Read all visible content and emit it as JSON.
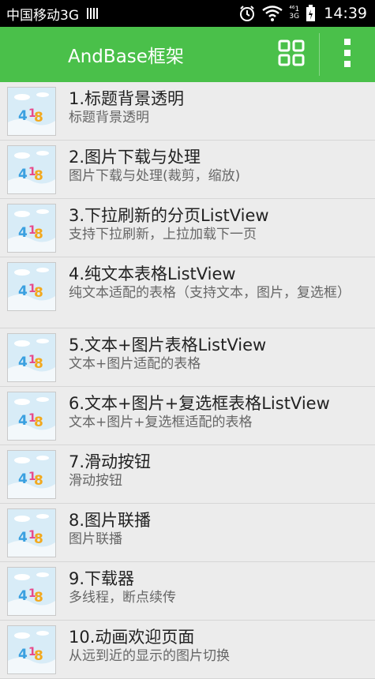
{
  "statusbar": {
    "carrier": "中国移动3G",
    "network_top": "⁴⁶1",
    "network_bottom": "3G",
    "time": "14:39",
    "icons": [
      "signal-bars-icon",
      "alarm-icon",
      "wifi-icon",
      "mobile-signal-icon",
      "battery-charging-icon"
    ]
  },
  "actionbar": {
    "title": "AndBase框架",
    "grid_icon": "grid-icon",
    "more_icon": "overflow-menu-icon"
  },
  "items": [
    {
      "title": "1.标题背景透明",
      "sub": "标题背景透明"
    },
    {
      "title": "2.图片下载与处理",
      "sub": "图片下载与处理(裁剪，缩放)"
    },
    {
      "title": "3.下拉刷新的分页ListView",
      "sub": "支持下拉刷新，上拉加载下一页"
    },
    {
      "title": "4.纯文本表格ListView",
      "sub": "纯文本适配的表格（支持文本，图片，复选框）"
    },
    {
      "title": "5.文本+图片表格ListView",
      "sub": "文本+图片适配的表格"
    },
    {
      "title": "6.文本+图片+复选框表格ListView",
      "sub": "文本+图片+复选框适配的表格"
    },
    {
      "title": "7.滑动按钮",
      "sub": "滑动按钮"
    },
    {
      "title": "8.图片联播",
      "sub": "图片联播"
    },
    {
      "title": "9.下载器",
      "sub": "多线程，断点续传"
    },
    {
      "title": "10.动画欢迎页面",
      "sub": "从远到近的显示的图片切换"
    }
  ]
}
